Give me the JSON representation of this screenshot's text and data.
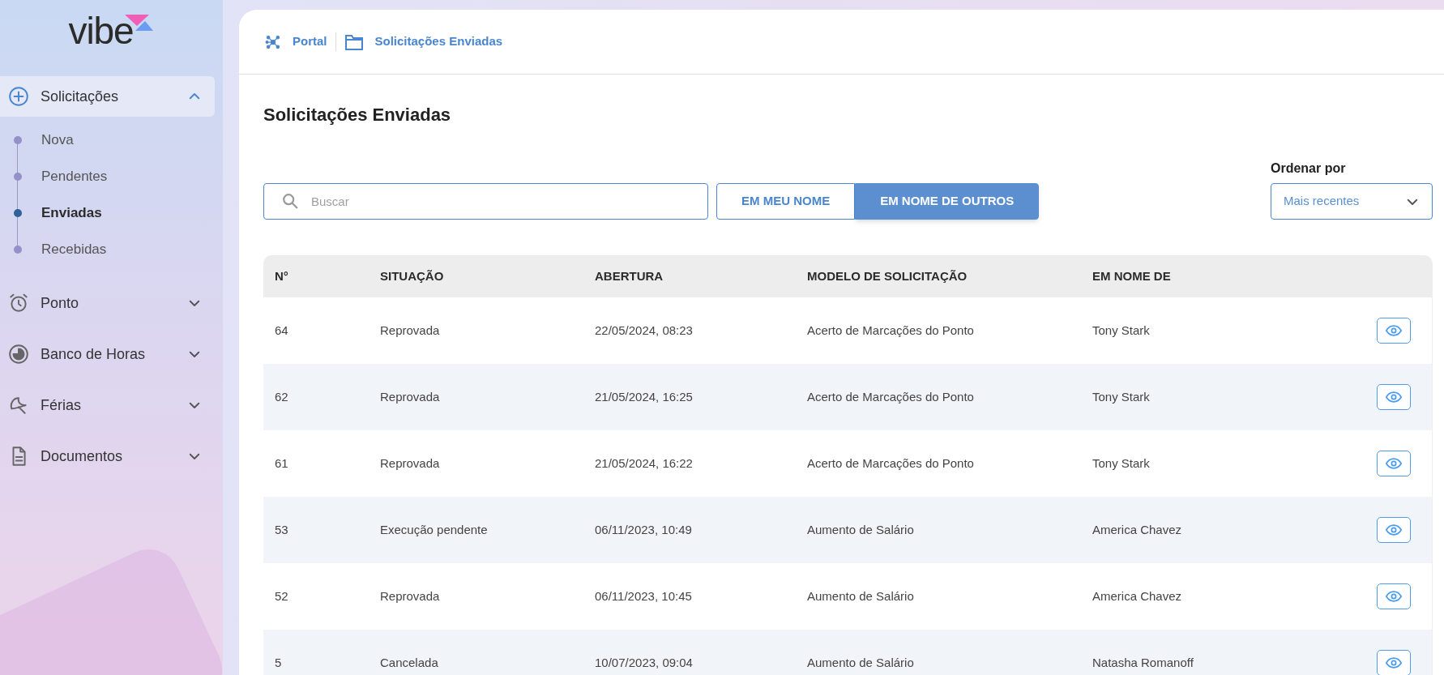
{
  "logo": {
    "text": "vibe"
  },
  "sidebar": {
    "items": [
      {
        "label": "Solicitações",
        "expanded": true,
        "children": [
          {
            "label": "Nova",
            "selected": false
          },
          {
            "label": "Pendentes",
            "selected": false
          },
          {
            "label": "Enviadas",
            "selected": true
          },
          {
            "label": "Recebidas",
            "selected": false
          }
        ]
      },
      {
        "label": "Ponto",
        "expanded": false
      },
      {
        "label": "Banco de Horas",
        "expanded": false
      },
      {
        "label": "Férias",
        "expanded": false
      },
      {
        "label": "Documentos",
        "expanded": false
      }
    ]
  },
  "breadcrumb": [
    {
      "label": "Portal"
    },
    {
      "label": "Solicitações Enviadas"
    }
  ],
  "page_title": "Solicitações Enviadas",
  "search": {
    "placeholder": "Buscar"
  },
  "filter_tabs": [
    {
      "label": "EM MEU NOME",
      "selected": false
    },
    {
      "label": "EM NOME DE OUTROS",
      "selected": true
    }
  ],
  "sort": {
    "label": "Ordenar por",
    "value": "Mais recentes"
  },
  "table": {
    "columns": [
      "N°",
      "SITUAÇÃO",
      "ABERTURA",
      "MODELO DE SOLICITAÇÃO",
      "EM NOME DE"
    ],
    "rows": [
      [
        "64",
        "Reprovada",
        "22/05/2024, 08:23",
        "Acerto de Marcações do Ponto",
        "Tony Stark"
      ],
      [
        "62",
        "Reprovada",
        "21/05/2024, 16:25",
        "Acerto de Marcações do Ponto",
        "Tony Stark"
      ],
      [
        "61",
        "Reprovada",
        "21/05/2024, 16:22",
        "Acerto de Marcações do Ponto",
        "Tony Stark"
      ],
      [
        "53",
        "Execução pendente",
        "06/11/2023, 10:49",
        "Aumento de Salário",
        "America Chavez"
      ],
      [
        "52",
        "Reprovada",
        "06/11/2023, 10:45",
        "Aumento de Salário",
        "America Chavez"
      ],
      [
        "5",
        "Cancelada",
        "10/07/2023, 09:04",
        "Aumento de Salário",
        "Natasha Romanoff"
      ]
    ]
  }
}
